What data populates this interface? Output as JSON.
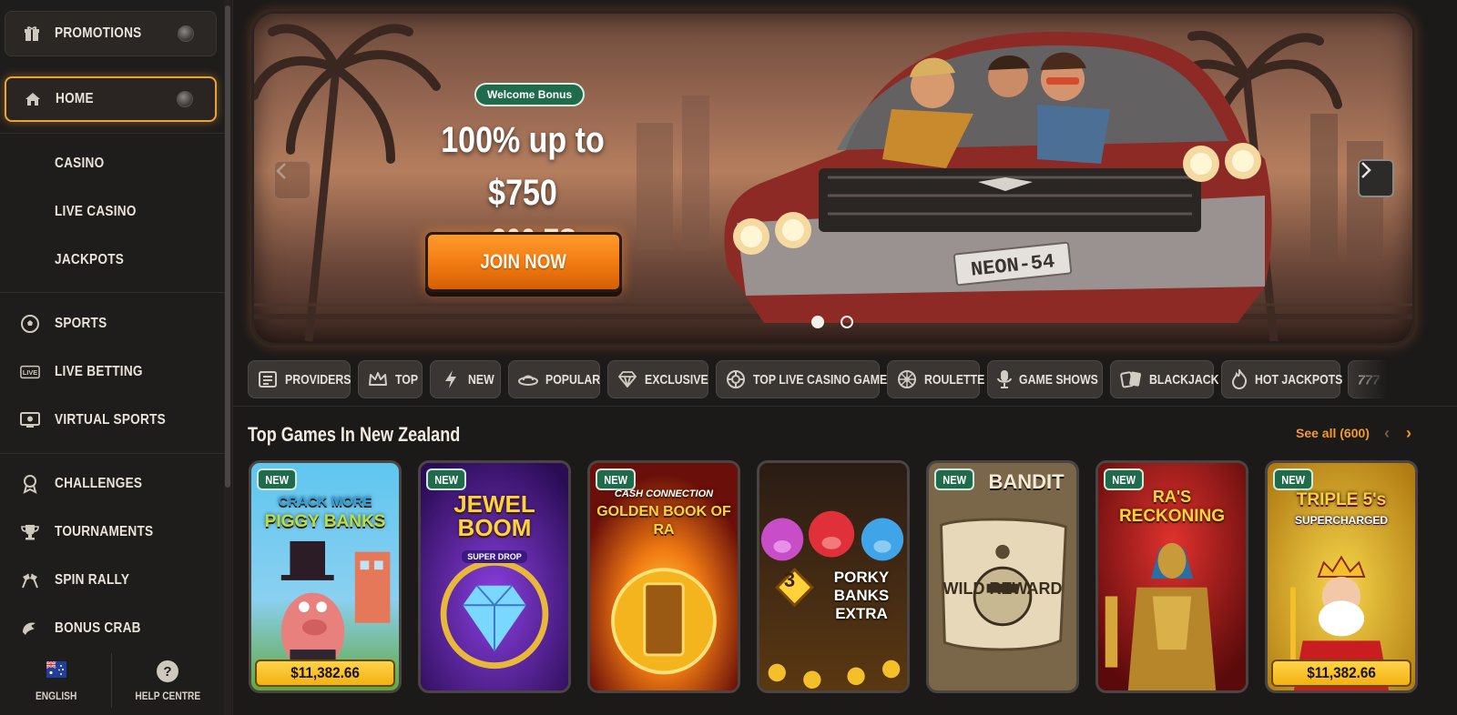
{
  "sidebar": {
    "promotions": {
      "label": "PROMOTIONS",
      "icon": "gift-icon"
    },
    "home": {
      "label": "HOME",
      "icon": "home-icon"
    },
    "casino_links": [
      "CASINO",
      "LIVE CASINO",
      "JACKPOTS"
    ],
    "sports_links": [
      {
        "label": "SPORTS",
        "icon": "soccer-ball-icon"
      },
      {
        "label": "LIVE BETTING",
        "icon": "live-icon"
      },
      {
        "label": "VIRTUAL SPORTS",
        "icon": "virtual-screen-icon"
      }
    ],
    "extra_links": [
      {
        "label": "CHALLENGES",
        "icon": "award-icon"
      },
      {
        "label": "TOURNAMENTS",
        "icon": "trophy-icon"
      },
      {
        "label": "SPIN RALLY",
        "icon": "race-flags-icon"
      },
      {
        "label": "BONUS CRAB",
        "icon": "claw-icon"
      }
    ],
    "footer": {
      "language": "ENGLISH",
      "help": "HELP CENTRE",
      "help_glyph": "?"
    }
  },
  "banner": {
    "badge": "Welcome Bonus",
    "line1": "100% up to $750",
    "line2": "+ 200 FS",
    "cta": "JOIN NOW",
    "plate": "NEON-54",
    "slides": 2,
    "active_slide": 1
  },
  "categories": [
    {
      "label": "PROVIDERS",
      "icon": "providers-icon"
    },
    {
      "label": "TOP",
      "icon": "crown-icon"
    },
    {
      "label": "NEW",
      "icon": "lightning-icon"
    },
    {
      "label": "POPULAR",
      "icon": "ufo-icon"
    },
    {
      "label": "EXCLUSIVE",
      "icon": "diamond-icon"
    },
    {
      "label": "TOP LIVE CASINO GAMES",
      "icon": "chip-icon"
    },
    {
      "label": "ROULETTE",
      "icon": "roulette-icon"
    },
    {
      "label": "GAME SHOWS",
      "icon": "microphone-icon"
    },
    {
      "label": "BLACKJACK",
      "icon": "cards-icon"
    },
    {
      "label": "HOT JACKPOTS",
      "icon": "flame-icon"
    },
    {
      "label": "",
      "icon": "sevens-icon"
    }
  ],
  "top_games": {
    "title": "Top Games In New Zealand",
    "see_all": "See all (600)",
    "prev": "‹",
    "next": "›",
    "games": [
      {
        "badge": "NEW",
        "title_top": "CRACK MORE",
        "title_bottom": "PIGGY BANKS",
        "jackpot": "$11,382.66"
      },
      {
        "badge": "NEW",
        "title_top": "JEWEL",
        "title_bottom": "BOOM",
        "sub": "SUPER DROP",
        "jackpot": ""
      },
      {
        "badge": "NEW",
        "title_top": "CASH CONNECTION",
        "title_bottom": "GOLDEN BOOK OF RA",
        "jackpot": ""
      },
      {
        "badge": "",
        "title_top": "3",
        "title_bottom": "PORKY BANKS EXTRA",
        "jackpot": ""
      },
      {
        "badge": "NEW",
        "title_top": "BANDIT",
        "title_bottom": "WILD REWARD",
        "jackpot": ""
      },
      {
        "badge": "NEW",
        "title_top": "RA'S",
        "title_bottom": "RECKONING",
        "jackpot": ""
      },
      {
        "badge": "NEW",
        "title_top": "TRIPLE 5's",
        "title_bottom": "SUPERCHARGED",
        "jackpot": "$11,382.66"
      }
    ]
  }
}
